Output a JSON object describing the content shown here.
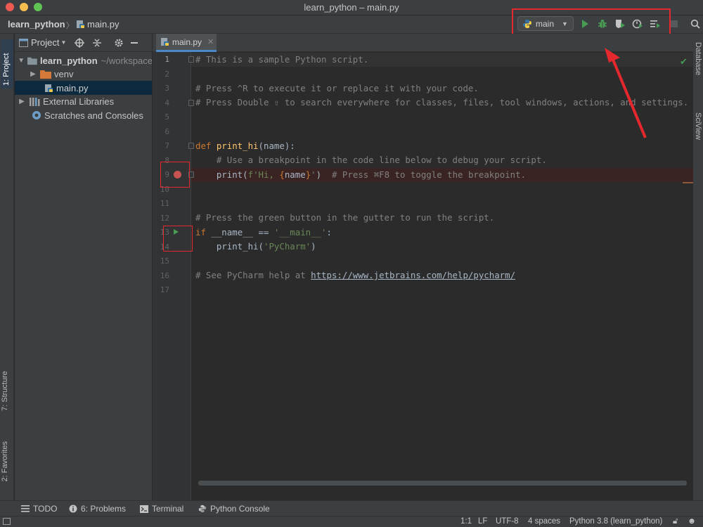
{
  "window": {
    "title": "learn_python – main.py"
  },
  "navbar": {
    "project": "learn_python",
    "file": "main.py"
  },
  "run_config": {
    "name": "main"
  },
  "toolbar_icons": [
    "run-icon",
    "debug-icon",
    "coverage-icon",
    "profile-icon",
    "run-concurrency-icon",
    "stop-icon",
    "search-icon"
  ],
  "left_tabs": {
    "project": "1: Project",
    "structure": "7: Structure",
    "favorites": "2: Favorites"
  },
  "right_tabs": {
    "database": "Database",
    "sciview": "SciView"
  },
  "project_panel": {
    "title": "Project",
    "tree": [
      {
        "label": "learn_python",
        "suffix": "~/workspace",
        "icon": "folder-icon"
      },
      {
        "label": "venv",
        "icon": "folder-icon"
      },
      {
        "label": "main.py",
        "icon": "python-file-icon"
      },
      {
        "label": "External Libraries",
        "icon": "library-icon"
      },
      {
        "label": "Scratches and Consoles",
        "icon": "scratches-icon"
      }
    ]
  },
  "editor": {
    "tab_label": "main.py",
    "line_numbers": [
      "1",
      "2",
      "3",
      "4",
      "5",
      "6",
      "7",
      "8",
      "9",
      "10",
      "11",
      "12",
      "13",
      "14",
      "15",
      "16",
      "17"
    ],
    "lines": {
      "l1": "# This is a sample Python script.",
      "l3": "# Press ^R to execute it or replace it with your code.",
      "l4": "# Press Double ⇧ to search everywhere for classes, files, tool windows, actions, and settings.",
      "l7_kw": "def ",
      "l7_fn": "print_hi",
      "l7_rest": "(name):",
      "l8": "    # Use a breakpoint in the code line below to debug your script.",
      "l9_a": "    print(",
      "l9_str1": "f'Hi, ",
      "l9_b1": "{",
      "l9_name": "name",
      "l9_b2": "}",
      "l9_str2": "'",
      "l9_c": ")  ",
      "l9_cmt": "# Press ⌘F8 to toggle the breakpoint.",
      "l12": "# Press the green button in the gutter to run the script.",
      "l13_kw": "if ",
      "l13_a": "__name__ == ",
      "l13_str": "'__main__'",
      "l13_c": ":",
      "l14_a": "    print_hi(",
      "l14_str": "'PyCharm'",
      "l14_c": ")",
      "l16_a": "# See PyCharm help at ",
      "l16_link": "https://www.jetbrains.com/help/pycharm/"
    }
  },
  "tool_windows": {
    "todo": "TODO",
    "problems": "6: Problems",
    "terminal": "Terminal",
    "python_console": "Python Console"
  },
  "status_bar": {
    "position": "1:1",
    "line_sep": "LF",
    "encoding": "UTF-8",
    "indent": "4 spaces",
    "interpreter": "Python 3.8 (learn_python)"
  },
  "colors": {
    "accent": "#4a88c7",
    "run_green": "#499c54",
    "breakpoint_red": "#c75450",
    "annotation_red": "#e5282d"
  }
}
